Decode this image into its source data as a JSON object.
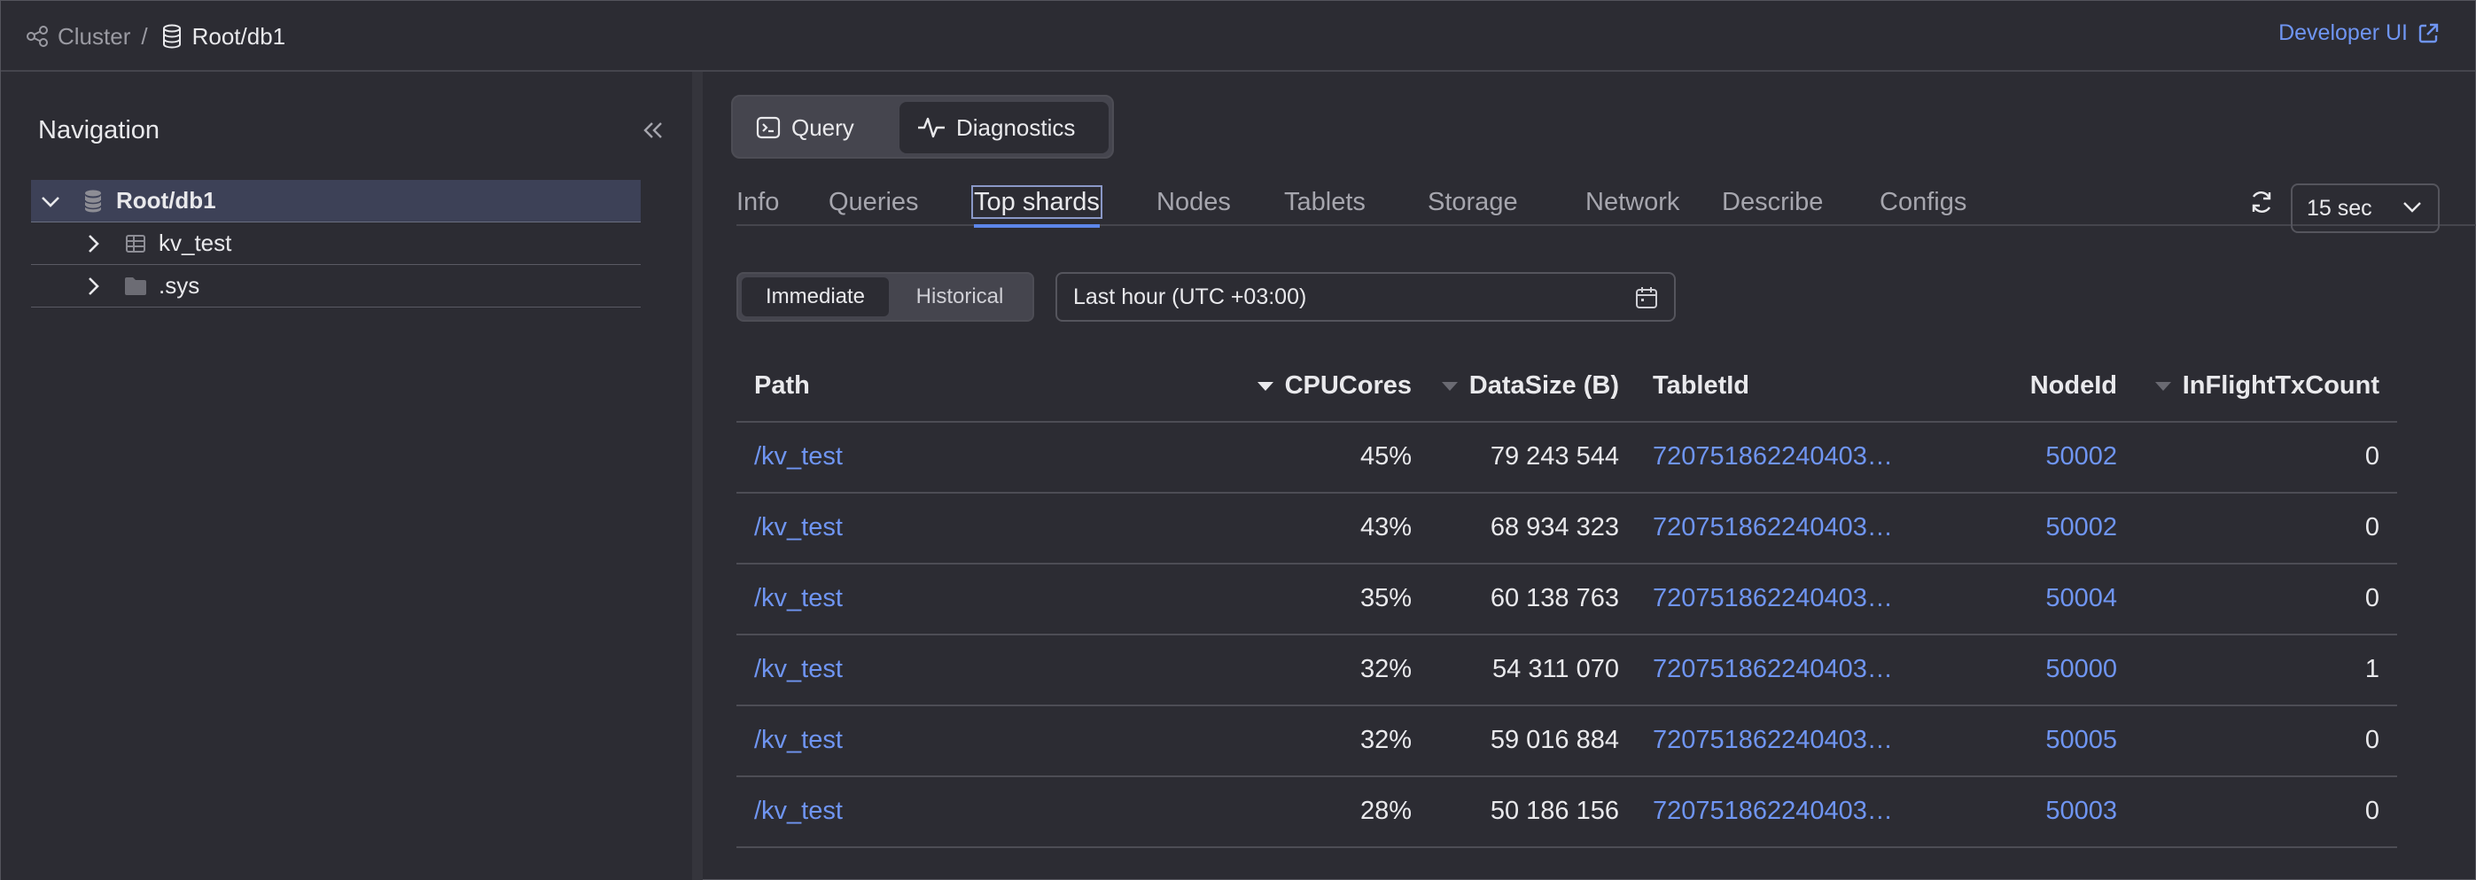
{
  "header": {
    "breadcrumb_cluster": "Cluster",
    "breadcrumb_sep": "/",
    "breadcrumb_db": "Root/db1",
    "developer_ui": "Developer UI"
  },
  "sidebar": {
    "title": "Navigation",
    "tree": [
      {
        "label": "Root/db1",
        "icon": "database-icon",
        "selected": true
      },
      {
        "label": "kv_test",
        "icon": "table-icon"
      },
      {
        "label": ".sys",
        "icon": "folder-icon"
      }
    ]
  },
  "mode": {
    "query": "Query",
    "diagnostics": "Diagnostics",
    "active": "Diagnostics"
  },
  "tabs": [
    "Info",
    "Queries",
    "Top shards",
    "Nodes",
    "Tablets",
    "Storage",
    "Network",
    "Describe",
    "Configs"
  ],
  "active_tab": "Top shards",
  "refresh_interval": "15 sec",
  "range_mode": {
    "immediate": "Immediate",
    "historical": "Historical",
    "active": "Immediate"
  },
  "date_range": "Last hour (UTC +03:00)",
  "table": {
    "headers": {
      "path": "Path",
      "cpu": "CPUCores",
      "size": "DataSize (B)",
      "tablet": "TabletId",
      "node": "NodeId",
      "inflight": "InFlightTxCount"
    },
    "rows": [
      {
        "path": "/kv_test",
        "cpu": "45%",
        "size": "79 243 544",
        "tablet": "720751862240403…",
        "node": "50002",
        "inflight": "0"
      },
      {
        "path": "/kv_test",
        "cpu": "43%",
        "size": "68 934 323",
        "tablet": "720751862240403…",
        "node": "50002",
        "inflight": "0"
      },
      {
        "path": "/kv_test",
        "cpu": "35%",
        "size": "60 138 763",
        "tablet": "720751862240403…",
        "node": "50004",
        "inflight": "0"
      },
      {
        "path": "/kv_test",
        "cpu": "32%",
        "size": "54 311 070",
        "tablet": "720751862240403…",
        "node": "50000",
        "inflight": "1"
      },
      {
        "path": "/kv_test",
        "cpu": "32%",
        "size": "59 016 884",
        "tablet": "720751862240403…",
        "node": "50005",
        "inflight": "0"
      },
      {
        "path": "/kv_test",
        "cpu": "28%",
        "size": "50 186 156",
        "tablet": "720751862240403…",
        "node": "50003",
        "inflight": "0"
      }
    ]
  },
  "colors": {
    "accent": "#6f95f2",
    "background": "#2c2c33",
    "selected_row": "#3d4157"
  }
}
